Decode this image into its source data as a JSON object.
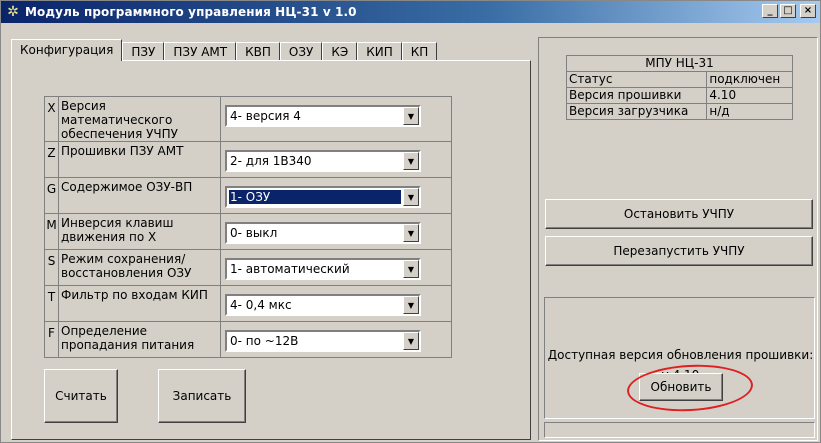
{
  "window": {
    "title": "Модуль программного управления НЦ-31 v 1.0",
    "min_label": "_",
    "max_label": "□",
    "close_label": "×"
  },
  "tabs": [
    {
      "label": "Конфигурация",
      "active": true
    },
    {
      "label": "ПЗУ"
    },
    {
      "label": "ПЗУ АМТ"
    },
    {
      "label": "КВП"
    },
    {
      "label": "ОЗУ"
    },
    {
      "label": "КЭ"
    },
    {
      "label": "КИП"
    },
    {
      "label": "КП"
    }
  ],
  "config": [
    {
      "letter": "X",
      "label": "Версия математического обеспечения УЧПУ",
      "value": "4- версия 4"
    },
    {
      "letter": "Z",
      "label": "Прошивки ПЗУ АМТ",
      "value": "2- для 1В340"
    },
    {
      "letter": "G",
      "label": "Содержимое ОЗУ-ВП",
      "value": "1- ОЗУ",
      "focused": true
    },
    {
      "letter": "M",
      "label": "Инверсия клавиш движения по X",
      "value": "0- выкл"
    },
    {
      "letter": "S",
      "label": "Режим сохранения/ восстановления ОЗУ",
      "value": "1- автоматический"
    },
    {
      "letter": "T",
      "label": "Фильтр по входам КИП",
      "value": "4- 0,4 мкс"
    },
    {
      "letter": "F",
      "label": "Определение пропадания питания",
      "value": "0- по ~12В"
    }
  ],
  "buttons": {
    "read": "Считать",
    "write": "Записать",
    "stop": "Остановить УЧПУ",
    "restart": "Перезапустить УЧПУ",
    "update": "Обновить"
  },
  "info": {
    "header": "МПУ НЦ-31",
    "rows": [
      {
        "key": "Статус",
        "value": "подключен"
      },
      {
        "key": "Версия прошивки",
        "value": "4.10"
      },
      {
        "key": "Версия загрузчика",
        "value": "н/д"
      }
    ]
  },
  "update": {
    "text": "Доступная версия обновления прошивки:",
    "version": "v 4.10"
  },
  "icons": {
    "app": "gear-icon",
    "dropdown": "chevron-down-icon"
  },
  "colors": {
    "titlebar": "#0a246a",
    "face": "#d4d0c8",
    "highlight": "#0a246a",
    "annotation": "#e02020"
  }
}
